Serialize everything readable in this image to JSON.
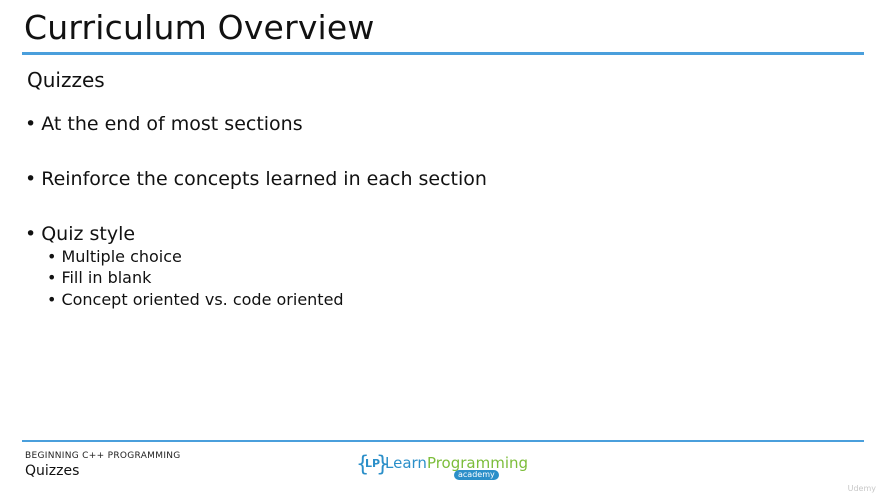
{
  "slide": {
    "title": "Curriculum Overview",
    "subtitle": "Quizzes",
    "bullets": [
      {
        "text": "At the end of most sections"
      },
      {
        "text": "Reinforce the concepts learned in each section"
      },
      {
        "text": "Quiz style",
        "subitems": [
          "Multiple choice",
          "Fill in blank",
          "Concept oriented vs. code oriented"
        ]
      }
    ],
    "bullet_glyph": "•"
  },
  "footer": {
    "course": "BEGINNING C++ PROGRAMMING",
    "section": "Quizzes",
    "logo": {
      "brace_open": "{",
      "brace_close": "}",
      "initials": "LP",
      "learn": "Learn",
      "programming": "Programming",
      "academy": "academy"
    },
    "watermark": "Udemy"
  },
  "colors": {
    "accent_rule": "#4a9fdc",
    "logo_blue": "#2b8fc9",
    "logo_green": "#7cbd3a"
  }
}
